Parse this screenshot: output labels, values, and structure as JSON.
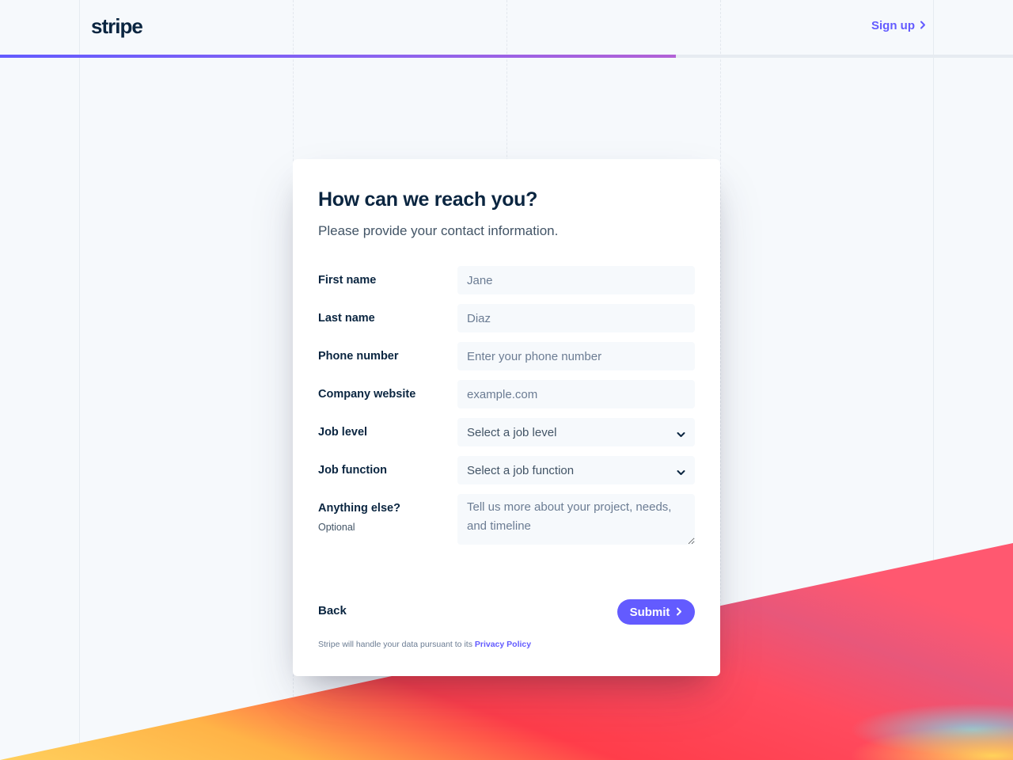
{
  "header": {
    "logo": "stripe",
    "signup_label": "Sign up"
  },
  "progress": {
    "fraction": 0.667
  },
  "form": {
    "title": "How can we reach you?",
    "subtitle": "Please provide your contact information.",
    "fields": {
      "first_name": {
        "label": "First name",
        "placeholder": "Jane"
      },
      "last_name": {
        "label": "Last name",
        "placeholder": "Diaz"
      },
      "phone": {
        "label": "Phone number",
        "placeholder": "Enter your phone number"
      },
      "website": {
        "label": "Company website",
        "placeholder": "example.com"
      },
      "job_level": {
        "label": "Job level",
        "value": "Select a job level"
      },
      "job_function": {
        "label": "Job function",
        "value": "Select a job function"
      },
      "anything_else": {
        "label": "Anything else?",
        "note": "Optional",
        "placeholder": "Tell us more about your project, needs, and timeline"
      }
    },
    "back_label": "Back",
    "submit_label": "Submit",
    "legal_text": "Stripe will handle your data pursuant to its",
    "privacy_link": "Privacy Policy"
  },
  "colors": {
    "accent": "#635bff",
    "text_dark": "#0a2540",
    "background": "#f6f9fc"
  },
  "icons": {
    "signup_chevron": "chevron-right-icon",
    "select_chevron": "chevron-down-icon",
    "submit_chevron": "chevron-right-icon"
  }
}
